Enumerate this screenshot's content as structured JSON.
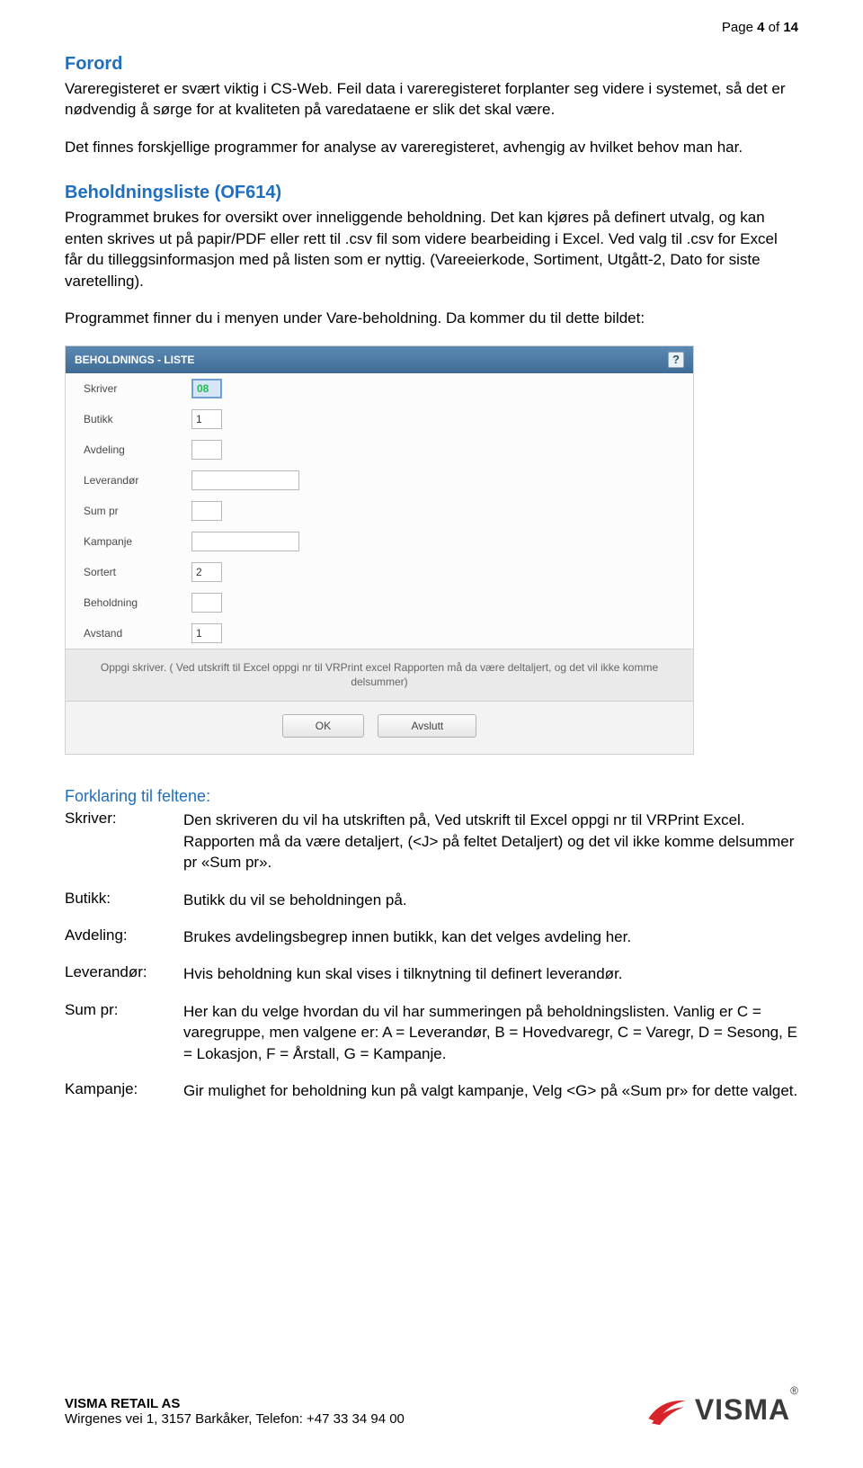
{
  "page_header": {
    "label": "Page",
    "current": "4",
    "of_word": "of",
    "total": "14"
  },
  "section1": {
    "title": "Forord",
    "p1": "Vareregisteret er svært viktig i CS-Web. Feil data i vareregisteret forplanter seg videre i systemet, så det er nødvendig å sørge for at kvaliteten på varedataene er slik det skal være.",
    "p2": "Det finnes forskjellige programmer for analyse av vareregisteret, avhengig av hvilket behov man har."
  },
  "section2": {
    "title": "Beholdningsliste (OF614)",
    "p1": "Programmet brukes for oversikt over inneliggende beholdning. Det kan kjøres på definert utvalg, og kan enten skrives ut på papir/PDF eller rett til .csv fil som videre bearbeiding i Excel. Ved valg til .csv for Excel får du tilleggsinformasjon med på listen som er nyttig. (Vareeierkode, Sortiment, Utgått-2, Dato for siste varetelling).",
    "p2": "Programmet finner du i menyen under Vare-beholdning. Da kommer du til dette bildet:"
  },
  "dialog": {
    "title": "BEHOLDNINGS - LISTE",
    "help": "?",
    "fields": {
      "skriver": {
        "label": "Skriver",
        "value": "08"
      },
      "butikk": {
        "label": "Butikk",
        "value": "1"
      },
      "avdeling": {
        "label": "Avdeling",
        "value": ""
      },
      "leverandor": {
        "label": "Leverandør",
        "value": ""
      },
      "sumpr": {
        "label": "Sum pr",
        "value": ""
      },
      "kampanje": {
        "label": "Kampanje",
        "value": ""
      },
      "sortert": {
        "label": "Sortert",
        "value": "2"
      },
      "beholdning": {
        "label": "Beholdning",
        "value": ""
      },
      "avstand": {
        "label": "Avstand",
        "value": "1"
      }
    },
    "hint": "Oppgi skriver. ( Ved utskrift til Excel oppgi nr til VRPrint excel Rapporten må da være deltaljert, og det vil ikke komme delsummer)",
    "ok": "OK",
    "avslutt": "Avslutt"
  },
  "explain": {
    "title": "Forklaring til feltene:",
    "rows": {
      "skriver": {
        "label": "Skriver:",
        "desc": "Den skriveren du vil ha utskriften på, Ved utskrift til Excel oppgi nr til VRPrint Excel. Rapporten må da være detaljert, (<J> på feltet Detaljert)  og det vil ikke komme delsummer pr «Sum pr»."
      },
      "butikk": {
        "label": "Butikk:",
        "desc": "Butikk du vil se beholdningen på."
      },
      "avdeling": {
        "label": "Avdeling:",
        "desc": "Brukes avdelingsbegrep innen butikk, kan det velges avdeling her."
      },
      "leverandor": {
        "label": "Leverandør:",
        "desc": "Hvis beholdning kun skal vises i tilknytning til definert leverandør."
      },
      "sumpr": {
        "label": "Sum pr:",
        "desc": "Her kan du velge hvordan du vil har summeringen på beholdningslisten. Vanlig er C = varegruppe, men valgene er: A = Leverandør, B = Hovedvaregr, C = Varegr, D = Sesong, E = Lokasjon, F = Årstall, G = Kampanje."
      },
      "kampanje": {
        "label": "Kampanje:",
        "desc": "Gir mulighet for beholdning kun på valgt kampanje, Velg <G> på «Sum pr» for dette valget."
      }
    }
  },
  "footer": {
    "company": "VISMA RETAIL AS",
    "addr": "Wirgenes vei 1, 3157 Barkåker, Telefon: +47 33 34 94 00",
    "logo_word": "VISMA",
    "reg": "®"
  }
}
